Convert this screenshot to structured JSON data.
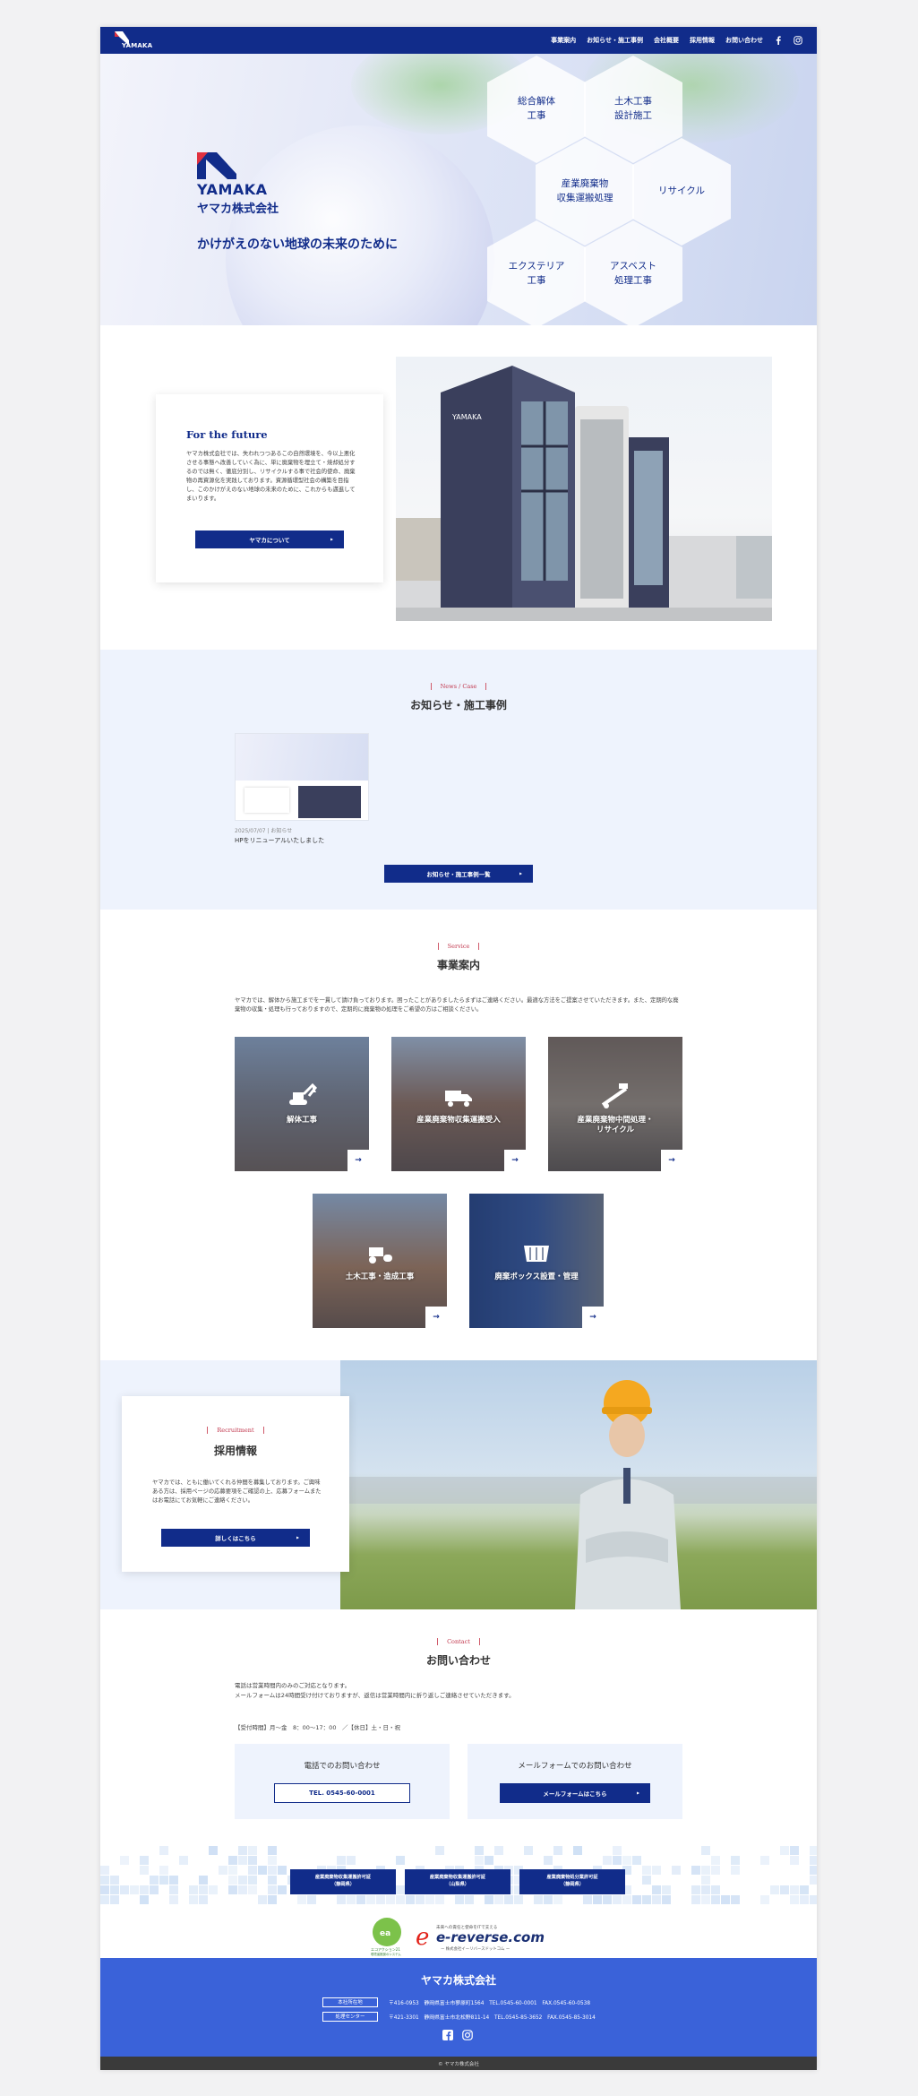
{
  "header": {
    "logo_text": "YAMAKA",
    "nav": [
      "事業案内",
      "お知らせ・施工事例",
      "会社概要",
      "採用情報",
      "お問い合わせ"
    ]
  },
  "hero": {
    "brand_en": "YAMAKA",
    "brand_jp": "ヤマカ株式会社",
    "tagline": "かけがえのない地球の未来のために",
    "hexes": [
      "総合解体\n工事",
      "土木工事\n設計施工",
      "産業廃棄物\n収集運搬処理",
      "リサイクル",
      "エクステリア\n工事",
      "アスベスト\n処理工事"
    ]
  },
  "about": {
    "title": "For the future",
    "text": "ヤマカ株式会社では、失われつつあるこの自然環境を、今以上悪化させる事態へ改善していく為に、単に廃棄物を埋立て・焼却処分するのでは無く、徹底分別し、リサイクルする事で社会的使命、廃棄物の再資源化を実践しております。資源循環型社会の構築を目指し、このかけがえのない地球の未来のために、これからも邁進してまいります。",
    "button": "ヤマカについて",
    "building_sign": "YAMAKA"
  },
  "news": {
    "label_en": "News / Case",
    "label_jp": "お知らせ・施工事例",
    "item_date": "2025/07/07 | お知らせ",
    "item_title": "HPをリニューアルいたしました",
    "button": "お知らせ・施工事例一覧"
  },
  "service": {
    "label_en": "Service",
    "label_jp": "事業案内",
    "lead": "ヤマカでは、解体から施工までを一貫して請け負っております。困ったことがありましたらまずはご連絡ください。最適な方法をご提案させていただきます。また、定期的な廃棄物の収集・処理も行っておりますので、定期的に廃棄物の処理をご希望の方はご相談ください。",
    "items": [
      {
        "label": "解体工事"
      },
      {
        "label": "産業廃棄物収集運搬受入"
      },
      {
        "label": "産業廃棄物中間処理・\nリサイクル"
      },
      {
        "label": "土木工事・造成工事"
      },
      {
        "label": "廃棄ボックス設置・管理"
      }
    ]
  },
  "recruit": {
    "label_en": "Recruitment",
    "label_jp": "採用情報",
    "text": "ヤマカでは、ともに働いてくれる仲間を募集しております。ご興味ある方は、採用ページの応募要項をご確認の上、応募フォームまたはお電話にてお気軽にご連絡ください。",
    "button": "詳しくはこちら"
  },
  "contact": {
    "label_en": "Contact",
    "label_jp": "お問い合わせ",
    "text1": "電話は営業時間内のみのご対応となります。",
    "text2": "メールフォームは24時間受け付けておりますが、返信は営業時間内に折り返しご連絡させていただきます。",
    "hours": "【受付時間】月～金　8：00～17：00　／【休日】土・日・祝",
    "tel_heading": "電話でのお問い合わせ",
    "tel_button": "TEL. 0545-60-0001",
    "mail_heading": "メールフォームでのお問い合わせ",
    "mail_button": "メールフォームはこちら"
  },
  "permits": [
    "産業廃棄物収集運搬許可証\n（静岡県）",
    "産業廃棄物収集運搬許可証\n（山梨県）",
    "産業廃棄物処分業許可証\n（静岡県）"
  ],
  "eco": {
    "ea_label": "エコアクション21",
    "ea_sub": "環境省推奨のシステム",
    "ereverse": "e-reverse.com",
    "ereverse_top": "未来への責任と使命をITで支える",
    "ereverse_sub": "ー 株式会社イーリバースドットコム ー"
  },
  "footer": {
    "logo": "ヤマカ株式会社",
    "rows": [
      {
        "tag": "本社所在地",
        "info": "〒416-0953　静岡県富士市蓼原町1564　TEL.0545-60-0001　FAX.0545-60-0538"
      },
      {
        "tag": "処理センター",
        "info": "〒421-3301　静岡県富士市北松野811-14　TEL.0545-85-3652　FAX.0545-85-3014"
      }
    ],
    "copyright": "© ヤマカ株式会社"
  },
  "colors": {
    "primary": "#112c8a",
    "accent": "#c0334a",
    "footer": "#3a62d9",
    "section_bg": "#eef3fd"
  }
}
